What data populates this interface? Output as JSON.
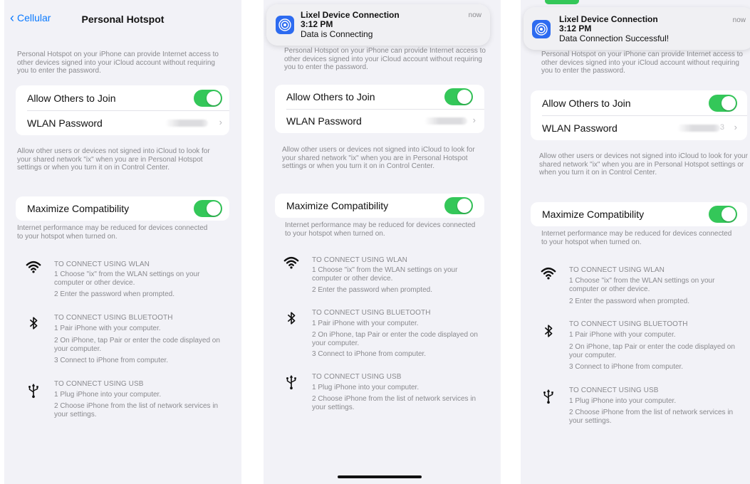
{
  "nav": {
    "back_label": "Cellular",
    "title": "Personal Hotspot"
  },
  "intro": "Personal Hotspot on your iPhone can provide Internet access to other devices signed into your iCloud account without requiring you to enter the password.",
  "allow_join": {
    "label": "Allow Others to Join",
    "on": true
  },
  "wlan_password": {
    "label": "WLAN Password",
    "tail": "3"
  },
  "allow_hint": "Allow other users or devices not signed into iCloud to look for your shared network \"ix\" when you are in Personal Hotspot settings or when you turn it on in Control Center.",
  "compat": {
    "label": "Maximize Compatibility",
    "on": true
  },
  "compat_hint": "Internet performance may be reduced for devices connected to your hotspot when turned on.",
  "methods": {
    "wlan": {
      "title": "TO CONNECT USING WLAN",
      "steps": [
        "1 Choose \"ix\" from the WLAN settings on your computer or other device.",
        "2 Enter the password when prompted."
      ]
    },
    "bluetooth": {
      "title": "TO CONNECT USING BLUETOOTH",
      "steps": [
        "1 Pair iPhone with your computer.",
        "2 On iPhone, tap Pair or enter the code displayed on your computer.",
        "3 Connect to iPhone from computer."
      ]
    },
    "usb": {
      "title": "TO CONNECT USING USB",
      "steps": [
        "1 Plug iPhone into your computer.",
        "2 Choose iPhone from the list of network services in your settings."
      ]
    }
  },
  "notifications": [
    {
      "app": "Lixel Device Connection",
      "time": "3:12 PM",
      "message": "Data is Connecting",
      "age": "now"
    },
    {
      "app": "Lixel Device Connection",
      "time": "3:12 PM",
      "message": "Data Connection Successful!",
      "age": "now"
    }
  ],
  "colors": {
    "accent": "#0a7aff",
    "toggle_on": "#34c759",
    "background": "#f2f2f7",
    "app_icon": "#2d6bf0"
  },
  "icons": [
    "chevron-left-icon",
    "chevron-right-icon",
    "wifi-icon",
    "bluetooth-icon",
    "usb-icon",
    "lixel-app-icon"
  ]
}
